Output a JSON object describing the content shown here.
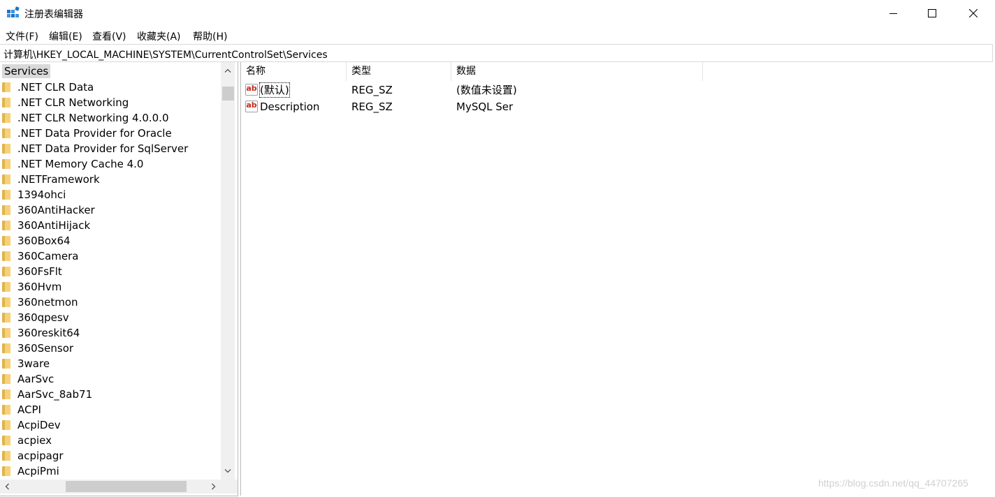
{
  "window": {
    "title": "注册表编辑器",
    "minimize_glyph": "—",
    "maximize_glyph": "☐",
    "close_glyph": "✕"
  },
  "menu": [
    {
      "label": "文件(F)"
    },
    {
      "label": "编辑(E)"
    },
    {
      "label": "查看(V)"
    },
    {
      "label": "收藏夹(A)"
    },
    {
      "label": "帮助(H)"
    }
  ],
  "address": "计算机\\HKEY_LOCAL_MACHINE\\SYSTEM\\CurrentControlSet\\Services",
  "tree": {
    "root": "Services",
    "items": [
      ".NET CLR Data",
      ".NET CLR Networking",
      ".NET CLR Networking 4.0.0.0",
      ".NET Data Provider for Oracle",
      ".NET Data Provider for SqlServer",
      ".NET Memory Cache 4.0",
      ".NETFramework",
      "1394ohci",
      "360AntiHacker",
      "360AntiHijack",
      "360Box64",
      "360Camera",
      "360FsFlt",
      "360Hvm",
      "360netmon",
      "360qpesv",
      "360reskit64",
      "360Sensor",
      "3ware",
      "AarSvc",
      "AarSvc_8ab71",
      "ACPI",
      "AcpiDev",
      "acpiex",
      "acpipagr",
      "AcpiPmi"
    ],
    "scroll_icons": {
      "up": "chevron-up-icon",
      "down": "chevron-down-icon",
      "left": "chevron-left-icon",
      "right": "chevron-right-icon"
    }
  },
  "values": {
    "columns": {
      "name": "名称",
      "type": "类型",
      "data": "数据"
    },
    "rows": [
      {
        "name": "(默认)",
        "type": "REG_SZ",
        "data": "(数值未设置)"
      },
      {
        "name": "Description",
        "type": "REG_SZ",
        "data": "MySQL Ser"
      }
    ],
    "icon_label": "ab"
  },
  "watermark": "https://blog.csdn.net/qq_44707265"
}
